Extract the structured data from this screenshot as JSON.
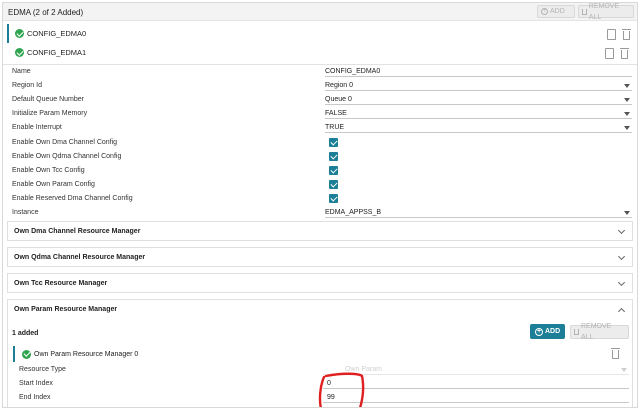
{
  "header": {
    "title": "EDMA (2 of 2 Added)",
    "add_label": "ADD",
    "remove_all_label": "REMOVE ALL"
  },
  "configs": [
    {
      "label": "CONFIG_EDMA0",
      "selected": true
    },
    {
      "label": "CONFIG_EDMA1",
      "selected": false
    }
  ],
  "properties": {
    "name": {
      "label": "Name",
      "value": "CONFIG_EDMA0"
    },
    "region_id": {
      "label": "Region Id",
      "value": "Region 0"
    },
    "default_queue": {
      "label": "Default Queue Number",
      "value": "Queue 0"
    },
    "init_param_memory": {
      "label": "Initialize Param Memory",
      "value": "FALSE"
    },
    "enable_interrupt": {
      "label": "Enable Interrupt",
      "value": "TRUE"
    },
    "own_dma_channel_config": {
      "label": "Enable Own Dma Channel Config",
      "checked": true
    },
    "own_qdma_channel_config": {
      "label": "Enable Own Qdma Channel Config",
      "checked": true
    },
    "own_tcc_config": {
      "label": "Enable Own Tcc Config",
      "checked": true
    },
    "own_param_config": {
      "label": "Enable Own Param Config",
      "checked": true
    },
    "reserved_dma_channel_config": {
      "label": "Enable Reserved Dma Channel Config",
      "checked": true
    },
    "instance": {
      "label": "Instance",
      "value": "EDMA_APPSS_B"
    }
  },
  "sections": {
    "dma": "Own Dma Channel Resource Manager",
    "qdma": "Own Qdma Channel Resource Manager",
    "tcc": "Own Tcc Resource Manager",
    "param": "Own Param Resource Manager"
  },
  "param_manager": {
    "added_text": "1 added",
    "add_label": "ADD",
    "remove_all_label": "REMOVE ALL",
    "item_label": "Own Param Resource Manager 0",
    "resource_type_label": "Resource Type",
    "resource_type_value": "Own Param",
    "start_index_label": "Start Index",
    "start_index_value": "0",
    "end_index_label": "End Index",
    "end_index_value": "99"
  },
  "colors": {
    "accent": "#1d7f97",
    "success": "#2ea44f",
    "annotation": "#e02020"
  }
}
